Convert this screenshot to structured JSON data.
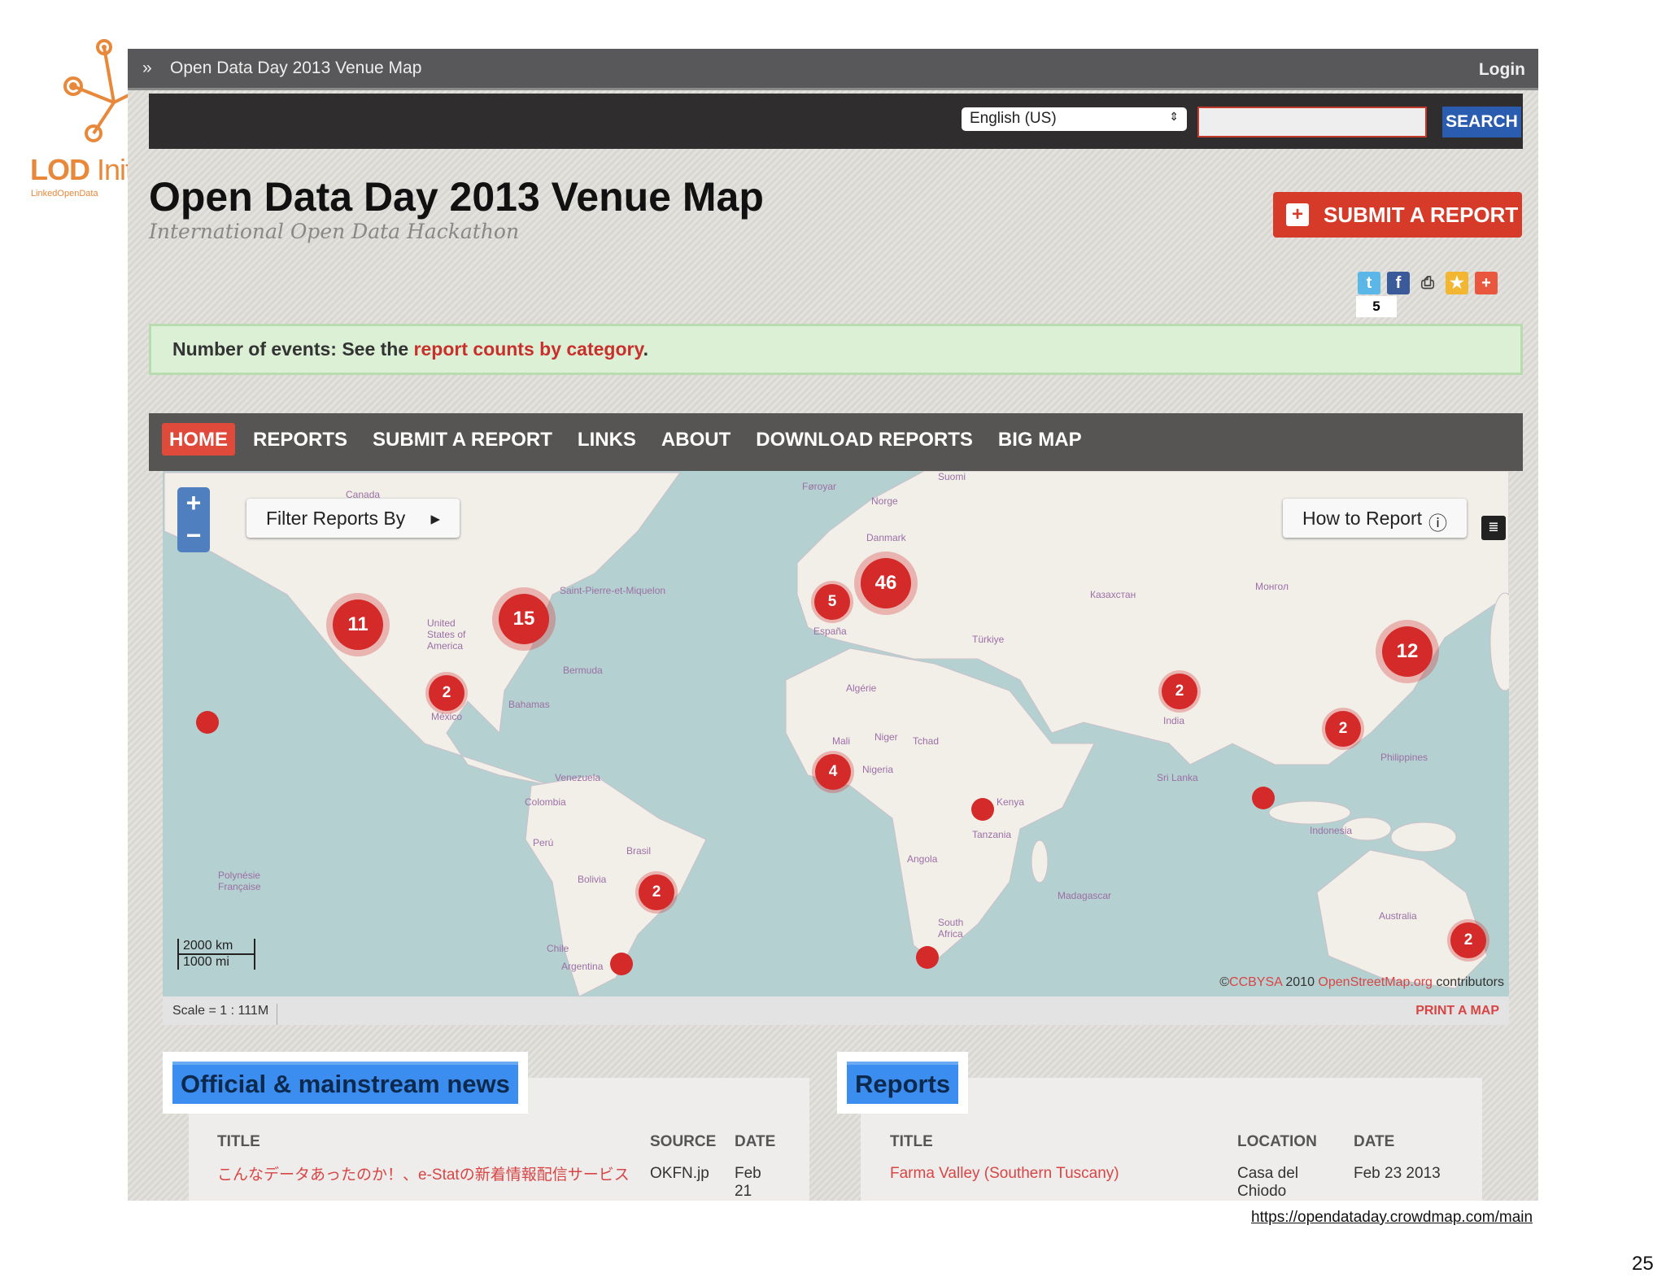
{
  "logo": {
    "text": "LOD Init",
    "subtitle": "LinkedOpenData"
  },
  "topbar": {
    "title": "Open Data Day 2013 Venue Map",
    "login": "Login"
  },
  "searchbar": {
    "language": "English (US)",
    "search_value": "",
    "search_button": "SEARCH"
  },
  "header": {
    "title": "Open Data Day 2013 Venue Map",
    "subtitle": "International Open Data Hackathon",
    "submit_button": "SUBMIT A REPORT"
  },
  "share": {
    "count": "5"
  },
  "notice": {
    "prefix": "Number of events: See the ",
    "link": "report counts by category",
    "suffix": "."
  },
  "nav": [
    "HOME",
    "REPORTS",
    "SUBMIT A REPORT",
    "LINKS",
    "ABOUT",
    "DOWNLOAD REPORTS",
    "BIG MAP"
  ],
  "map": {
    "filter_label": "Filter Reports By",
    "howto_label": "How to Report",
    "scale_km": "2000 km",
    "scale_mi": "1000 mi",
    "attribution": {
      "prefix": "©",
      "cc": "CCBYSA",
      "year": " 2010 ",
      "osm": "OpenStreetMap.org",
      "suffix": " contributors"
    },
    "cluster_counts": [
      "11",
      "15",
      "2",
      "46",
      "5",
      "4",
      "2",
      "12",
      "2",
      "2",
      "2"
    ],
    "labels": [
      "Canada",
      "United States of America",
      "México",
      "Bahamas",
      "Brasil",
      "Bolivia",
      "Perú",
      "Colombia",
      "Venezuela",
      "Argentina",
      "Chile",
      "Polynésie Française",
      "Føroyar",
      "Norge",
      "Suomi",
      "Danmark",
      "España",
      "Algérie",
      "Mali",
      "Niger",
      "Tchad",
      "Nigeria",
      "Kenya",
      "Angola",
      "South Africa",
      "Tanzania",
      "Madagascar",
      "India",
      "Sri Lanka",
      "Казахстан",
      "Монгол",
      "Indonesia",
      "Australia",
      "Philippines",
      "Türkiye",
      "Saint-Pierre-et-Miquelon",
      "Bermuda"
    ]
  },
  "scalebar": {
    "scale": "Scale = 1 : 111M",
    "print": "PRINT A MAP"
  },
  "news": {
    "heading": "Official & mainstream news",
    "columns": [
      "TITLE",
      "SOURCE",
      "DATE"
    ],
    "rows": [
      {
        "title": "こんなデータあったのか！、e-Statの新着情報配信サービス",
        "source": "OKFN.jp",
        "date": "Feb 21"
      }
    ]
  },
  "reports": {
    "heading": "Reports",
    "columns": [
      "TITLE",
      "LOCATION",
      "DATE"
    ],
    "rows": [
      {
        "title": "Farma Valley (Southern Tuscany)",
        "location": "Casa del Chiodo",
        "date": "Feb 23 2013"
      }
    ]
  },
  "footer": {
    "url": "https://opendataday.crowdmap.com/main",
    "page": "25"
  },
  "colors": {
    "accent": "#d63b2a",
    "nav": "#575553",
    "notice": "#dcf0d6",
    "search": "#2a5db0",
    "heading": "#3b8ef0"
  }
}
